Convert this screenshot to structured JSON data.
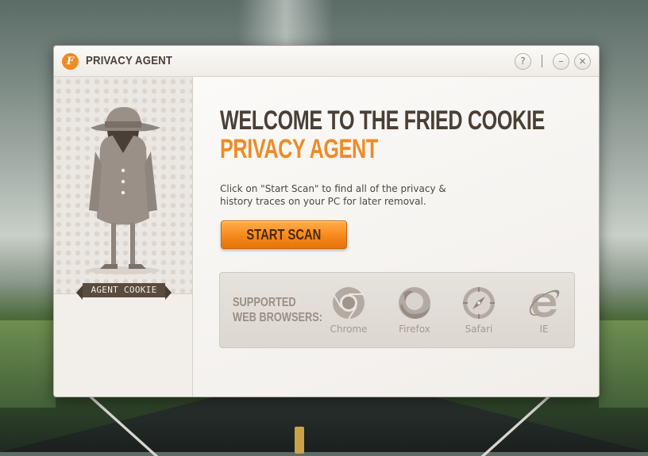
{
  "window": {
    "title": "PRIVACY AGENT",
    "logo_letter": "F"
  },
  "controls": {
    "help": "?",
    "minimize": "–",
    "close": "×"
  },
  "sidebar": {
    "agent_label": "AGENT COOKIE"
  },
  "main": {
    "headline": "WELCOME TO THE FRIED COOKIE",
    "headline_accent": "PRIVACY AGENT",
    "description_line1": "Click on \"Start Scan\" to find all of the privacy &",
    "description_line2": "history traces on your PC for later removal.",
    "start_button": "START SCAN"
  },
  "browsers": {
    "label_line1": "SUPPORTED",
    "label_line2": "WEB BROWSERS:",
    "items": [
      {
        "name": "Chrome",
        "icon": "chrome-icon"
      },
      {
        "name": "Firefox",
        "icon": "firefox-icon"
      },
      {
        "name": "Safari",
        "icon": "safari-icon"
      },
      {
        "name": "IE",
        "icon": "ie-icon"
      }
    ]
  },
  "colors": {
    "accent": "#f08a24",
    "heading": "#4b3f35",
    "muted": "#a49a90"
  }
}
